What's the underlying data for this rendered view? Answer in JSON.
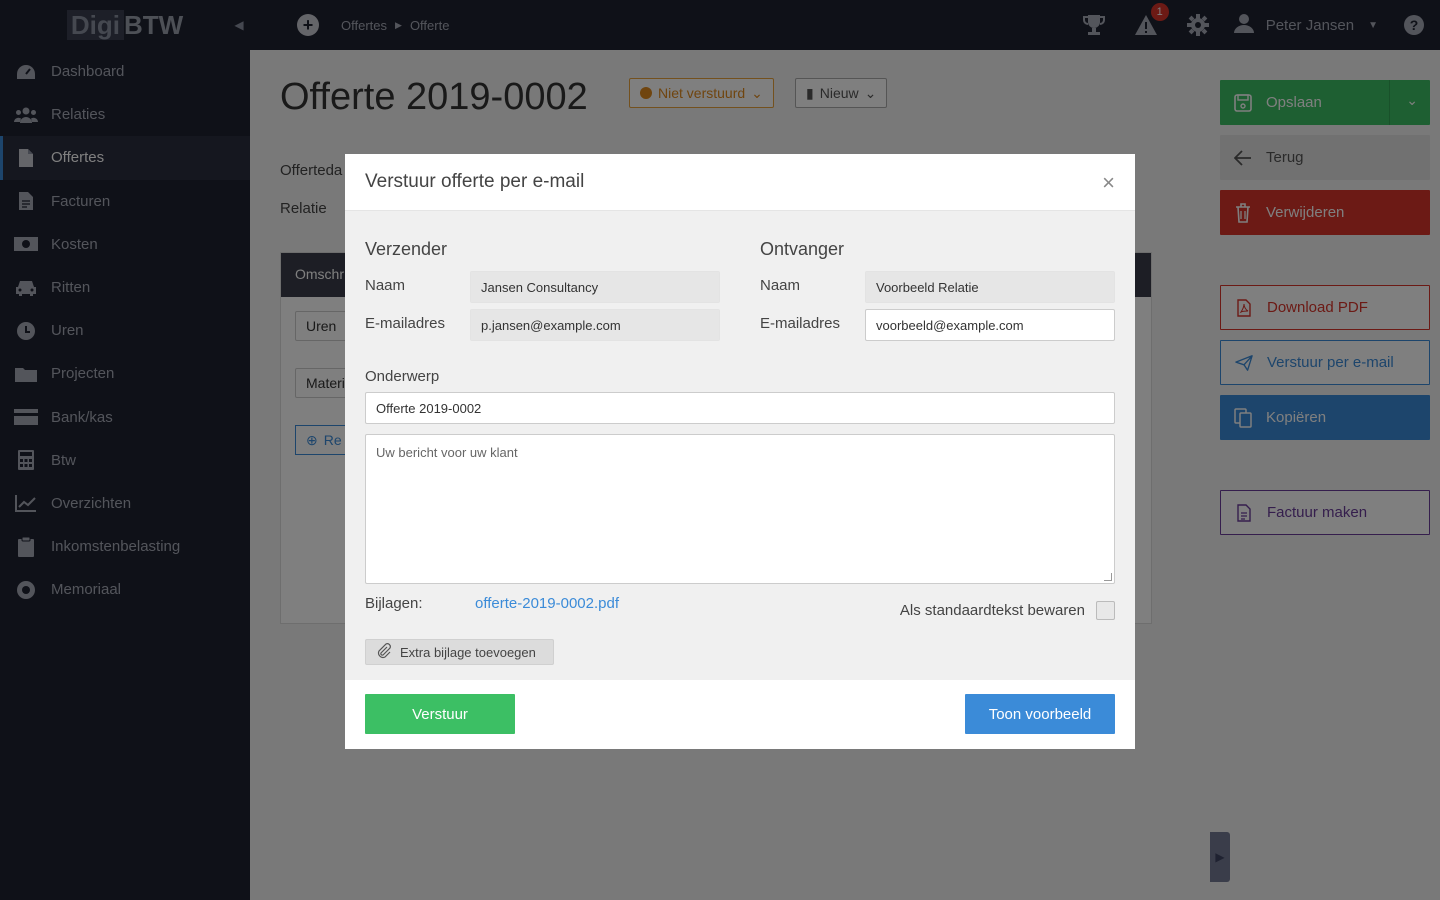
{
  "app": {
    "logo_a": "Digi",
    "logo_b": "BTW"
  },
  "sidebar": {
    "items": [
      {
        "label": "Dashboard",
        "icon": "dashboard-icon"
      },
      {
        "label": "Relaties",
        "icon": "users-icon"
      },
      {
        "label": "Offertes",
        "icon": "document-icon",
        "active": true
      },
      {
        "label": "Facturen",
        "icon": "invoice-icon"
      },
      {
        "label": "Kosten",
        "icon": "money-icon"
      },
      {
        "label": "Ritten",
        "icon": "car-icon"
      },
      {
        "label": "Uren",
        "icon": "clock-icon"
      },
      {
        "label": "Projecten",
        "icon": "folder-icon"
      },
      {
        "label": "Bank/kas",
        "icon": "card-icon"
      },
      {
        "label": "Btw",
        "icon": "calculator-icon"
      },
      {
        "label": "Overzichten",
        "icon": "chart-icon"
      },
      {
        "label": "Inkomstenbelasting",
        "icon": "clipboard-icon"
      },
      {
        "label": "Memoriaal",
        "icon": "lifebuoy-icon"
      }
    ]
  },
  "topbar": {
    "breadcrumb": [
      "Offertes",
      "Offerte"
    ],
    "notification_count": "1",
    "user_name": "Peter Jansen"
  },
  "page": {
    "title": "Offerte 2019-0002",
    "status_label": "Niet verstuurd",
    "type_label": "Nieuw",
    "label_date": "Offerteda",
    "label_relation": "Relatie",
    "table_head": "Omschr",
    "row1": "Uren",
    "row2": "Materi",
    "add_line": "Re"
  },
  "actions": {
    "save": "Opslaan",
    "back": "Terug",
    "delete": "Verwijderen",
    "download_pdf": "Download PDF",
    "send_email": "Verstuur per e-mail",
    "copy": "Kopiëren",
    "make_invoice": "Factuur maken"
  },
  "modal": {
    "title": "Verstuur offerte per e-mail",
    "sender": {
      "heading": "Verzender",
      "name_label": "Naam",
      "name_value": "Jansen Consultancy",
      "email_label": "E-mailadres",
      "email_value": "p.jansen@example.com"
    },
    "recipient": {
      "heading": "Ontvanger",
      "name_label": "Naam",
      "name_value": "Voorbeeld Relatie",
      "email_label": "E-mailadres",
      "email_value": "voorbeeld@example.com"
    },
    "subject_label": "Onderwerp",
    "subject_value": "Offerte 2019-0002",
    "message_placeholder": "Uw bericht voor uw klant",
    "attachments_label": "Bijlagen:",
    "attachment_file": "offerte-2019-0002.pdf",
    "save_default_label": "Als standaardtekst bewaren",
    "extra_attachment": "Extra bijlage toevoegen",
    "send": "Verstuur",
    "preview": "Toon voorbeeld"
  },
  "colors": {
    "sidebar_bg": "#1f2231",
    "green": "#3cbf64",
    "blue": "#3b8bd8",
    "red": "#d9352b",
    "orange": "#e08a1e",
    "purple": "#6a3d9a"
  }
}
